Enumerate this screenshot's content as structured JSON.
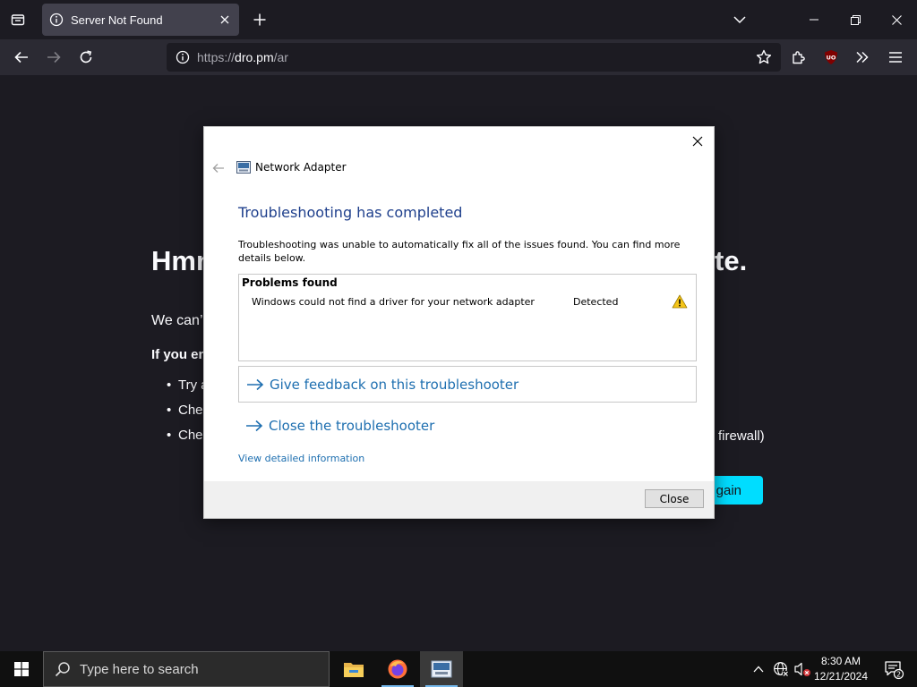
{
  "browser": {
    "tab": {
      "title": "Server Not Found"
    },
    "url": {
      "scheme": "https://",
      "host": "dro.pm",
      "path": "/ar"
    },
    "extension_badge": "UO"
  },
  "page": {
    "heading_left": "Hmm",
    "heading_right": "te.",
    "line1": "We can’",
    "line2": "If you en",
    "bullets": [
      "Try a",
      "Chec",
      "Chec"
    ],
    "firewall_fragment": "firewall)",
    "try_again_fragment": "gain"
  },
  "dialog": {
    "title": "Network Adapter",
    "heading": "Troubleshooting has completed",
    "description": "Troubleshooting was unable to automatically fix all of the issues found. You can find more details below.",
    "problems_title": "Problems found",
    "problems": [
      {
        "issue": "Windows could not find a driver for your network adapter",
        "status": "Detected",
        "icon": "warning-icon"
      }
    ],
    "feedback_link": "Give feedback on this troubleshooter",
    "close_link": "Close the troubleshooter",
    "view_detail": "View detailed information",
    "close_button": "Close"
  },
  "taskbar": {
    "search_placeholder": "Type here to search",
    "time": "8:30 AM",
    "date": "12/21/2024",
    "notification_count": "2",
    "apps": [
      "file-explorer-icon",
      "firefox-icon",
      "troubleshooter-icon"
    ]
  },
  "colors": {
    "dialog_heading": "#1e3f8c",
    "link": "#1e6fb0",
    "try_again": "#00ddff",
    "browser_bg": "#1c1b22"
  }
}
